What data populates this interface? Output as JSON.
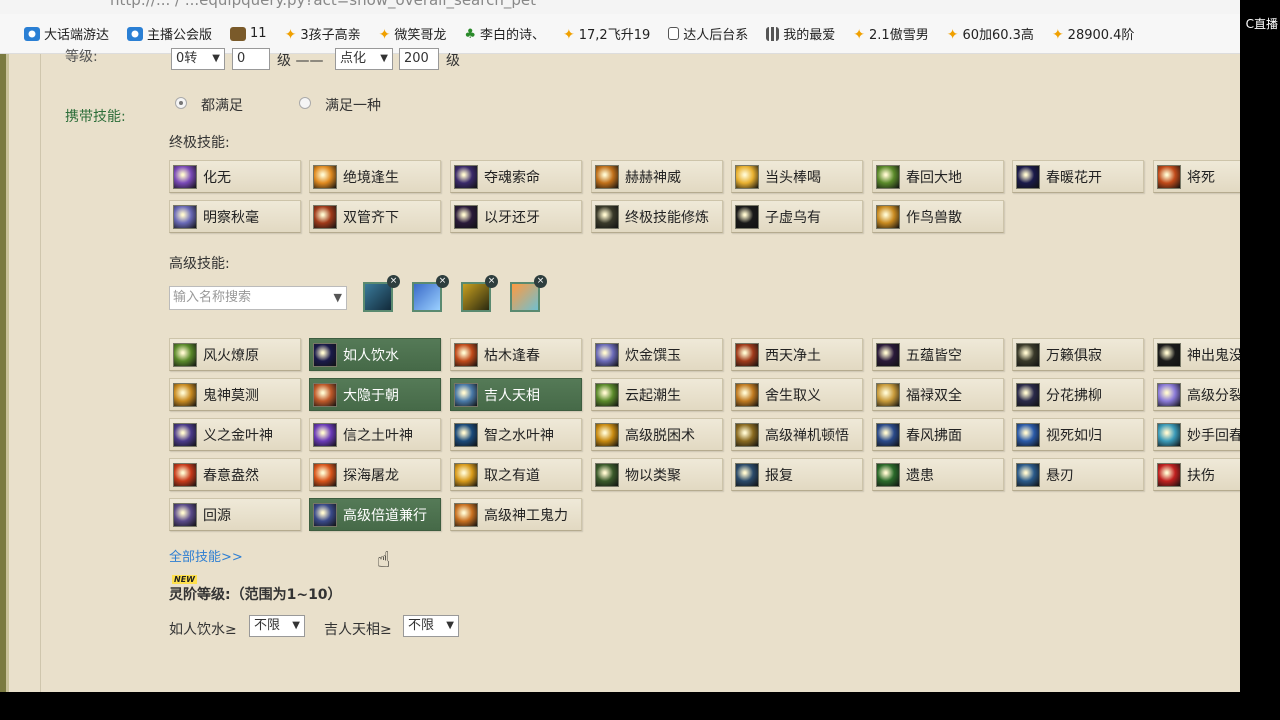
{
  "browser": {
    "url_fragment": "http://... / ...equipquery.py?act=show_overall_search_pet",
    "overlay_tag": "C直播",
    "bookmarks": [
      {
        "label": "大话端游达",
        "icon": "browser-e-icon"
      },
      {
        "label": "主播公会版",
        "icon": "browser-e-icon"
      },
      {
        "label": "11",
        "icon": "picture-icon"
      },
      {
        "label": "3孩子高亲",
        "icon": "star-icon"
      },
      {
        "label": "微笑哥龙",
        "icon": "star-icon"
      },
      {
        "label": "李白的诗、",
        "icon": "tree-icon"
      },
      {
        "label": "17,2飞升19",
        "icon": "star-icon"
      },
      {
        "label": "达人后台系",
        "icon": "document-icon"
      },
      {
        "label": "我的最爱",
        "icon": "grid-icon"
      },
      {
        "label": "2.1傲雪男",
        "icon": "star-icon"
      },
      {
        "label": "60加60.3高",
        "icon": "star-icon"
      },
      {
        "label": "28900.4阶",
        "icon": "star-icon"
      }
    ]
  },
  "level": {
    "label": "等级:",
    "rebirth_select": "0转",
    "level_input": "0",
    "mid_text": "级 ——",
    "type_select": "点化",
    "max_input": "200",
    "suffix": "级"
  },
  "skills": {
    "carry_label": "携带技能:",
    "radio_all": "都满足",
    "radio_any": "满足一种",
    "ultimate_label": "终极技能:",
    "ultimate": [
      "化无",
      "绝境逢生",
      "夺魂索命",
      "赫赫神威",
      "当头棒喝",
      "春回大地",
      "春暖花开",
      "将死",
      "明察秋毫",
      "双管齐下",
      "以牙还牙",
      "终极技能修炼",
      "子虚乌有",
      "作鸟兽散"
    ],
    "advanced_label": "高级技能:",
    "search_placeholder": "输入名称搜索",
    "advanced": [
      {
        "name": "风火燎原",
        "active": false
      },
      {
        "name": "如人饮水",
        "active": true
      },
      {
        "name": "枯木逢春",
        "active": false
      },
      {
        "name": "炊金馔玉",
        "active": false
      },
      {
        "name": "西天净土",
        "active": false
      },
      {
        "name": "五蕴皆空",
        "active": false
      },
      {
        "name": "万籁俱寂",
        "active": false
      },
      {
        "name": "神出鬼没",
        "active": false
      },
      {
        "name": "鬼神莫测",
        "active": false
      },
      {
        "name": "大隐于朝",
        "active": true
      },
      {
        "name": "吉人天相",
        "active": true
      },
      {
        "name": "云起潮生",
        "active": false
      },
      {
        "name": "舍生取义",
        "active": false
      },
      {
        "name": "福禄双全",
        "active": false
      },
      {
        "name": "分花拂柳",
        "active": false
      },
      {
        "name": "高级分裂",
        "active": false
      },
      {
        "name": "义之金叶神",
        "active": false
      },
      {
        "name": "信之土叶神",
        "active": false
      },
      {
        "name": "智之水叶神",
        "active": false
      },
      {
        "name": "高级脱困术",
        "active": false
      },
      {
        "name": "高级禅机顿悟",
        "active": false
      },
      {
        "name": "春风拂面",
        "active": false
      },
      {
        "name": "视死如归",
        "active": false
      },
      {
        "name": "妙手回春",
        "active": false
      },
      {
        "name": "春意盎然",
        "active": false
      },
      {
        "name": "探海屠龙",
        "active": false
      },
      {
        "name": "取之有道",
        "active": false
      },
      {
        "name": "物以类聚",
        "active": false
      },
      {
        "name": "报复",
        "active": false
      },
      {
        "name": "遗患",
        "active": false
      },
      {
        "name": "悬刃",
        "active": false
      },
      {
        "name": "扶伤",
        "active": false
      },
      {
        "name": "回源",
        "active": false
      },
      {
        "name": "高级倍道兼行",
        "active": true
      },
      {
        "name": "高级神工鬼力",
        "active": false
      }
    ],
    "all_link": "全部技能>>"
  },
  "spirit": {
    "new_badge": "NEW",
    "title": "灵阶等级:（范围为1~10）",
    "item1_label": "如人饮水≥",
    "item1_value": "不限",
    "item2_label": "吉人天相≥",
    "item2_value": "不限"
  },
  "colors": {
    "page_bg": "#e9e0cb",
    "active_skill": "#4e7250",
    "label_green": "#2d6e3a",
    "link_blue": "#2f7fd2"
  }
}
